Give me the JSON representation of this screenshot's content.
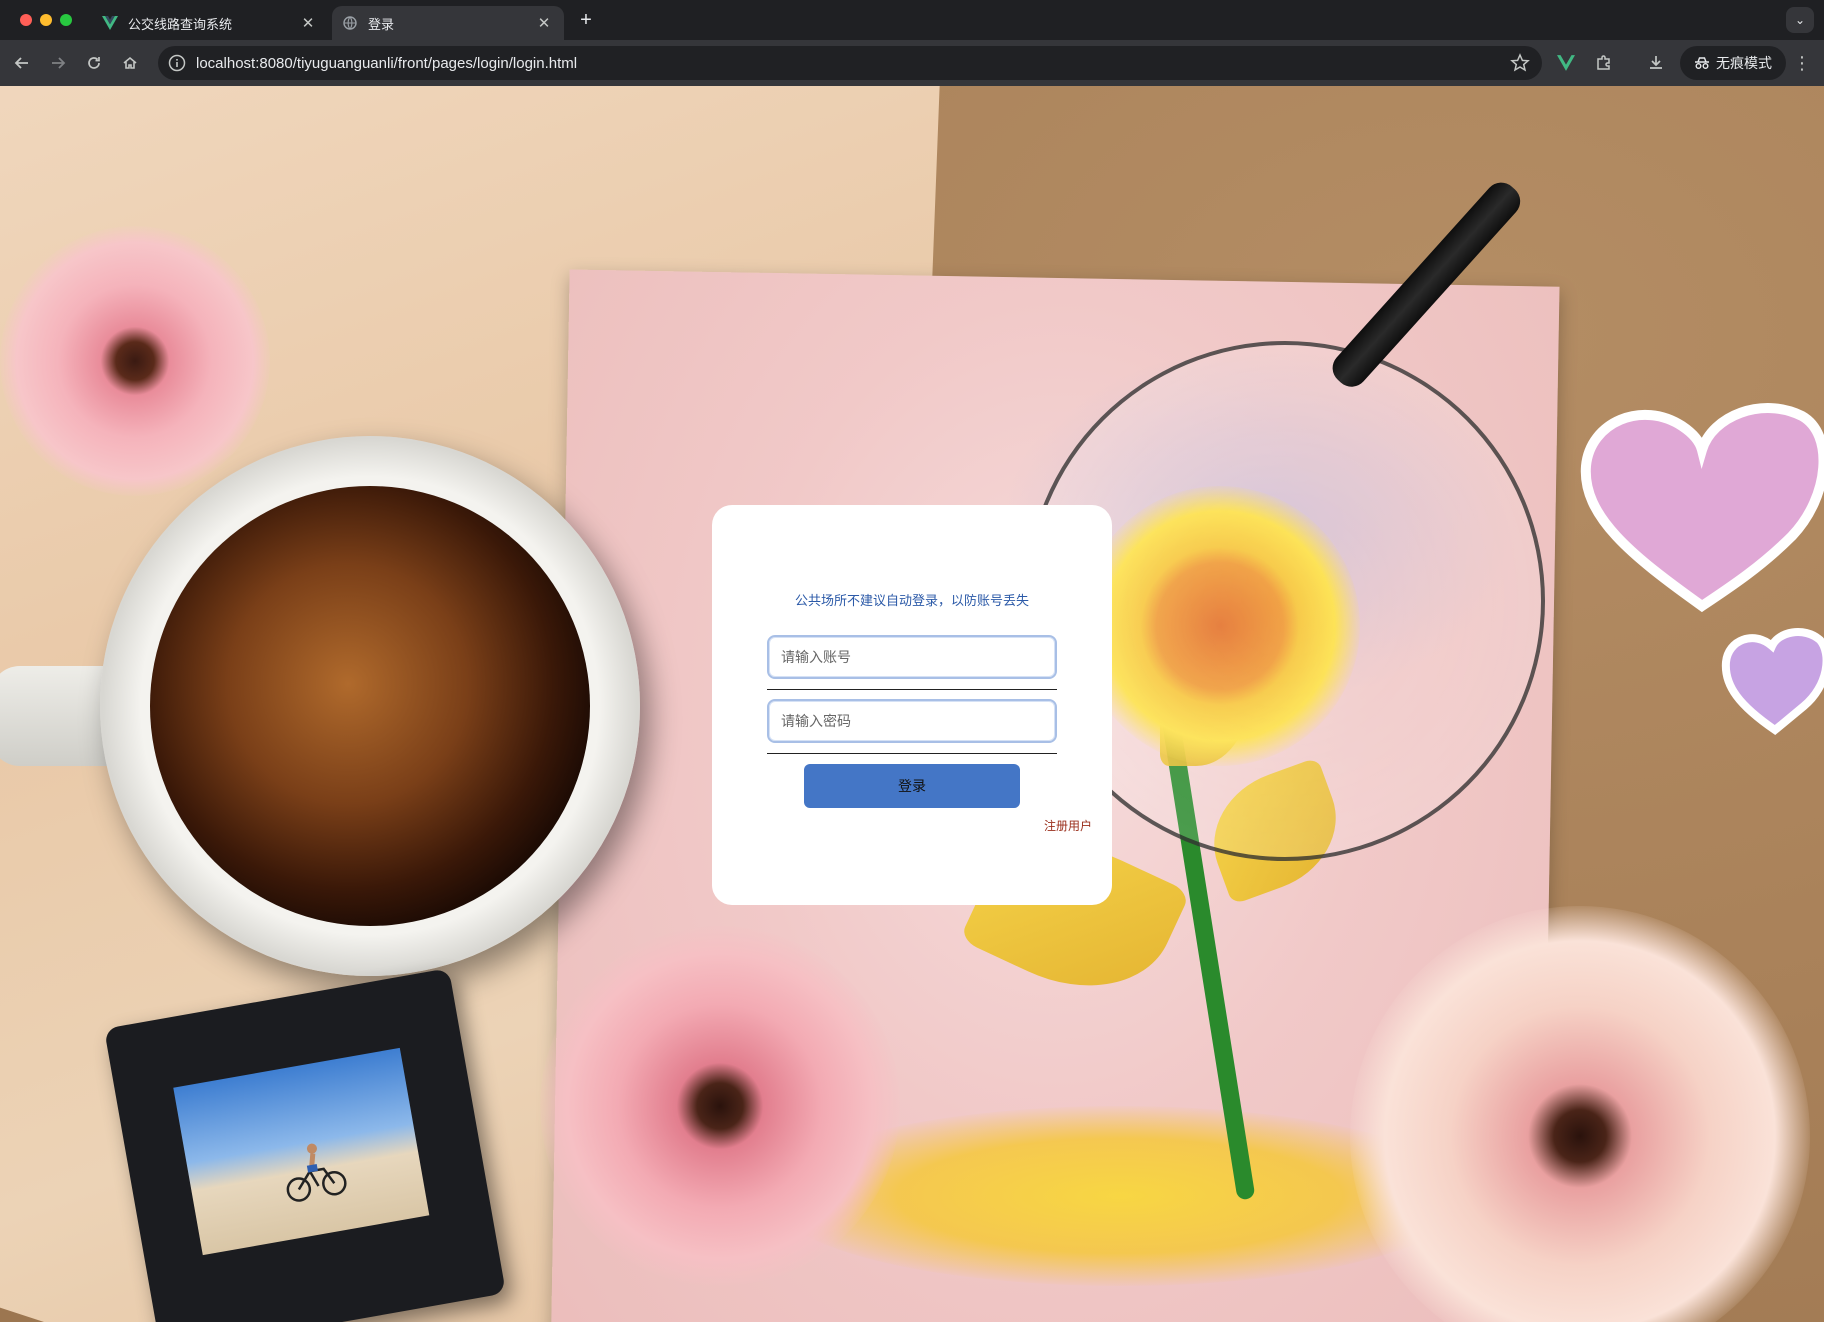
{
  "browser": {
    "tabs": [
      {
        "title": "公交线路查询系统",
        "active": false
      },
      {
        "title": "登录",
        "active": true
      }
    ],
    "new_tab": "+",
    "address": "localhost:8080/tiyuguanguanli/front/pages/login/login.html",
    "incognito_label": "无痕模式"
  },
  "login": {
    "notice": "公共场所不建议自动登录，以防账号丢失",
    "username_placeholder": "请输入账号",
    "username_value": "",
    "password_placeholder": "请输入密码",
    "password_value": "",
    "login_label": "登录",
    "register_label": "注册用户"
  },
  "colors": {
    "accent": "#4476c6",
    "notice": "#2c5aa8",
    "register": "#9a2f1c"
  },
  "icons": {
    "back": "arrow-left-icon",
    "forward": "arrow-right-icon",
    "reload": "reload-icon",
    "home": "home-icon",
    "info": "info-icon",
    "bookmark": "star-icon",
    "vue_extension": "vue-icon",
    "extensions": "puzzle-icon",
    "downloads": "download-icon",
    "incognito": "incognito-icon",
    "menu": "kebab-menu-icon"
  }
}
